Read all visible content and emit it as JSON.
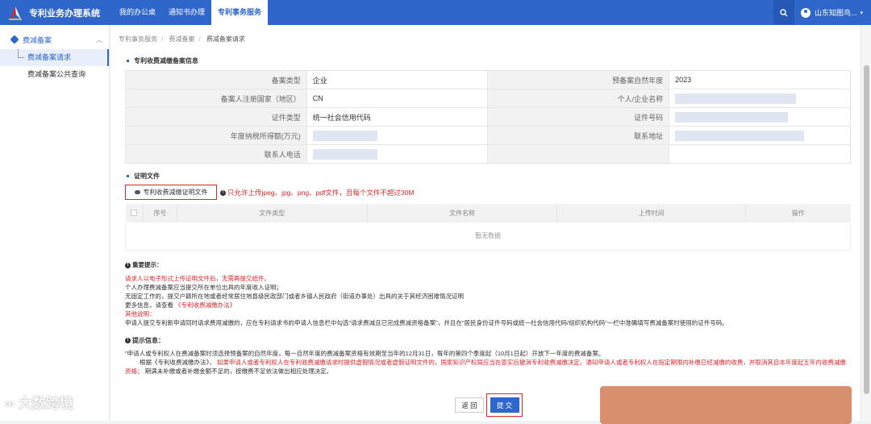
{
  "header": {
    "app_title": "专利业务办理系统",
    "nav": [
      {
        "label": "我的办公桌",
        "active": false
      },
      {
        "label": "通知书办理",
        "active": false
      },
      {
        "label": "专利事务服务",
        "active": true
      }
    ],
    "user_name": "山东知图鸟..."
  },
  "sidebar": {
    "group_label": "费减备案",
    "items": [
      {
        "label": "费减备案请求",
        "active": true
      },
      {
        "label": "费减备案公共查询",
        "active": false
      }
    ]
  },
  "breadcrumb": [
    "专利事务服务",
    "费减备案",
    "费减备案请求"
  ],
  "section_info": {
    "title": "专利收费减缴备案信息",
    "rows": [
      {
        "label1": "备案类型",
        "value1": "企业",
        "label2": "预备案自然年度",
        "value2": "2023"
      },
      {
        "label1": "备案人注册国家（地区）",
        "value1": "CN",
        "label2": "个人/企业名称",
        "value2": ""
      },
      {
        "label1": "证件类型",
        "value1": "统一社会信用代码",
        "label2": "证件号码",
        "value2": ""
      },
      {
        "label1": "年度纳税所得额(万元)",
        "value1": "",
        "label2": "联系地址",
        "value2": ""
      },
      {
        "label1": "联系人电话",
        "value1": "",
        "label2": "",
        "value2": ""
      }
    ]
  },
  "section_files": {
    "title": "证明文件",
    "upload_button": "专利收费减缴证明文件",
    "upload_tip": "只允许上传jpeg、jpg、png、pdf文件，且每个文件不超过30M",
    "columns": [
      "序号",
      "文件类型",
      "文件名称",
      "上传时间",
      "操作"
    ],
    "empty_text": "暂无数据"
  },
  "important": {
    "head": "重要提示：",
    "lines": [
      {
        "text": "请求人以电子形式上传证明文件后，无需再提交纸件。",
        "color": "red"
      },
      {
        "text": "个人办理费减备案应当提交所在单位出具的年度收入证明；",
        "color": "black"
      },
      {
        "text": "无固定工作的，提交户籍所在地或者经常居住地县级民政部门或者乡镇人民政府（街道办事处）出具的关于其经济困难情况证明",
        "color": "black"
      },
      {
        "text": "更多信息，请查看《专利收费减缴办法》",
        "color": "black",
        "link": "《专利收费减缴办法》"
      },
      {
        "text": "其他说明：",
        "color": "red"
      },
      {
        "text": "申请人提交专利新申请同时请求费用减缴的，应在专利请求书的申请人信息栏中勾选\"请求费减且已完成费减资格备案\"，并且在\"居民身份证件号码或统一社会信用代码/组织机构代码\"一栏中准确填写费减备案时使用的证件号码。",
        "color": "black"
      }
    ]
  },
  "hint": {
    "head": "提示信息：",
    "line1": "\"申请人或专利权人在费减备案时须选择预备案的自然年度，每一自然年度的费减备案资格有效期至当年的12月31日，每年的第四个季度起（10月1日起）开放下一年度的费减备案。",
    "line2_black": "根据《专利收费减缴办法》，",
    "line2_red": "如果申请人或者专利权人在专利收费减缴请求时提供虚假情况或者虚假证明文件的，国家知识产权局应当在查实后撤消专利收费减缴决定，通知申请人或者专利权人在指定期限内补缴已经减缴的收费，并取消其自本年度起五年内收费减缴资格；",
    "line2_tail": "期满未补缴或者补缴金额不足的，按缴费不足依法做出相应处理决定。"
  },
  "buttons": {
    "back": "返 回",
    "submit": "提 交"
  },
  "watermark": "大数跨境",
  "colors": {
    "primary": "#2f66c9",
    "highlight_red": "#e0262b",
    "redaction": "#d88f6e"
  }
}
